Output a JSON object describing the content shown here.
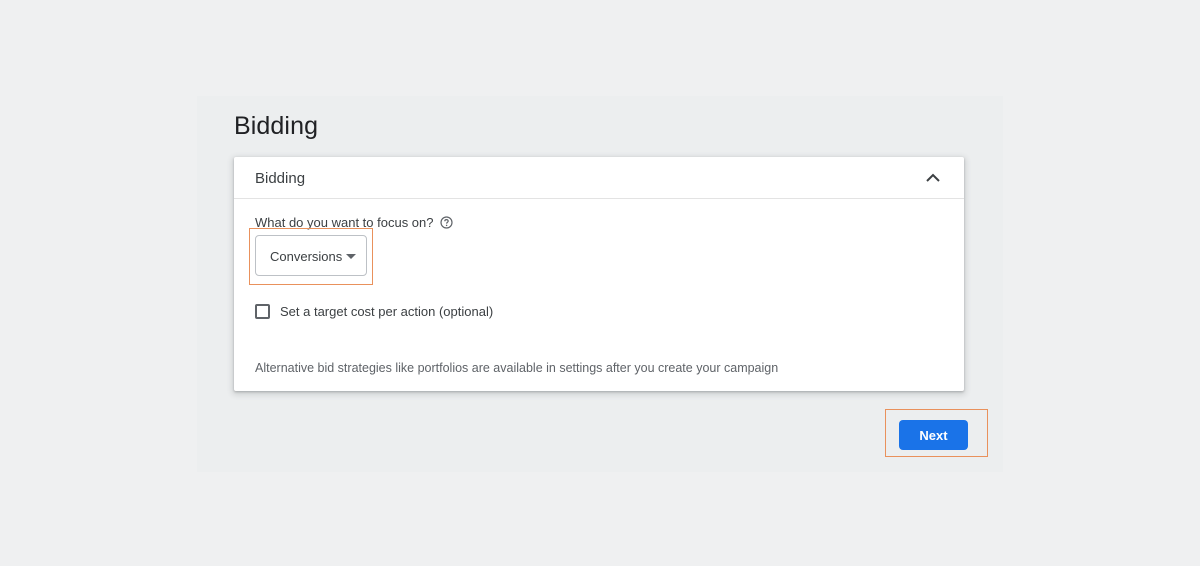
{
  "page": {
    "title": "Bidding"
  },
  "card": {
    "title": "Bidding",
    "collapse_icon": "chevron-up-icon",
    "focus_question": "What do you want to focus on?",
    "help_icon": "help-circle-icon",
    "focus_select": {
      "selected": "Conversions"
    },
    "target_cpa_checkbox": {
      "label": "Set a target cost per action (optional)",
      "checked": false
    },
    "footnote": "Alternative bid strategies like portfolios are available in settings after you create your campaign"
  },
  "actions": {
    "next_label": "Next"
  },
  "colors": {
    "primary": "#1a73e8",
    "highlight": "#e9915c",
    "background": "#eff0f1"
  }
}
